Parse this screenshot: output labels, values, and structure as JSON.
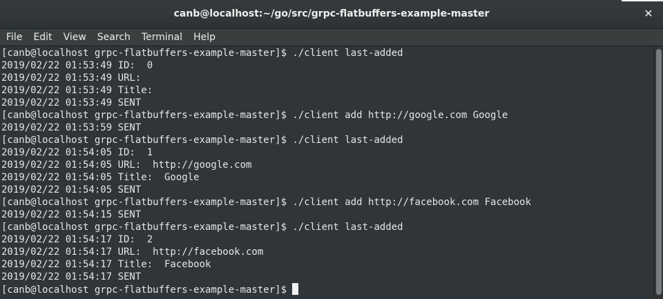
{
  "window": {
    "title": "canb@localhost:~/go/src/grpc-flatbuffers-example-master",
    "close_glyph": "✕"
  },
  "menu": [
    "File",
    "Edit",
    "View",
    "Search",
    "Terminal",
    "Help"
  ],
  "terminal": {
    "lines": [
      "[canb@localhost grpc-flatbuffers-example-master]$ ./client last-added",
      "2019/02/22 01:53:49 ID:  0",
      "2019/02/22 01:53:49 URL:",
      "2019/02/22 01:53:49 Title:",
      "2019/02/22 01:53:49 SENT",
      "[canb@localhost grpc-flatbuffers-example-master]$ ./client add http://google.com Google",
      "2019/02/22 01:53:59 SENT",
      "[canb@localhost grpc-flatbuffers-example-master]$ ./client last-added",
      "2019/02/22 01:54:05 ID:  1",
      "2019/02/22 01:54:05 URL:  http://google.com",
      "2019/02/22 01:54:05 Title:  Google",
      "2019/02/22 01:54:05 SENT",
      "[canb@localhost grpc-flatbuffers-example-master]$ ./client add http://facebook.com Facebook",
      "2019/02/22 01:54:15 SENT",
      "[canb@localhost grpc-flatbuffers-example-master]$ ./client last-added",
      "2019/02/22 01:54:17 ID:  2",
      "2019/02/22 01:54:17 URL:  http://facebook.com",
      "2019/02/22 01:54:17 Title:  Facebook",
      "2019/02/22 01:54:17 SENT"
    ],
    "prompt": "[canb@localhost grpc-flatbuffers-example-master]$ "
  }
}
